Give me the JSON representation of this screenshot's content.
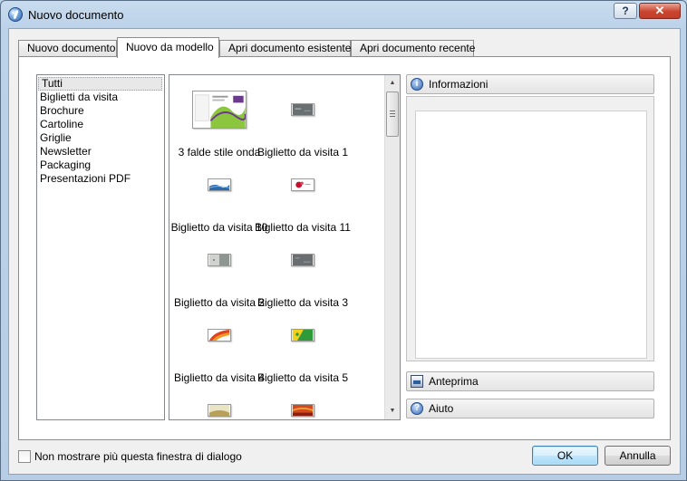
{
  "window": {
    "title": "Nuovo documento",
    "help_label": "?",
    "close_label": "✕"
  },
  "tabs": [
    {
      "label": "Nuovo documento",
      "active": false
    },
    {
      "label": "Nuovo da modello",
      "active": true
    },
    {
      "label": "Apri documento esistente",
      "active": false
    },
    {
      "label": "Apri documento recente",
      "active": false
    }
  ],
  "categories": {
    "selected": "Tutti",
    "items": [
      "Tutti",
      "Biglietti da visita",
      "Brochure",
      "Cartoline",
      "Griglie",
      "Newsletter",
      "Packaging",
      "Presentazioni PDF"
    ]
  },
  "templates": [
    {
      "label": "3 falde stile onda",
      "icon": "brochure-thumbnail",
      "colors": [
        "#ffffff",
        "#8cc63f",
        "#6b3a8c"
      ]
    },
    {
      "label": "Biglietto da visita 1",
      "icon": "business-card-thumbnail",
      "colors": [
        "#6a6f72",
        "#9aa0a3"
      ]
    },
    {
      "label": "Biglietto da visita 10",
      "icon": "business-card-thumbnail",
      "colors": [
        "#ffffff",
        "#2a6aad"
      ]
    },
    {
      "label": "Biglietto da visita 11",
      "icon": "business-card-thumbnail",
      "colors": [
        "#ffffff",
        "#c8102e"
      ]
    },
    {
      "label": "Biglietto da visita 2",
      "icon": "business-card-thumbnail",
      "colors": [
        "#cfd3cf",
        "#8e9692"
      ]
    },
    {
      "label": "Biglietto da visita 3",
      "icon": "business-card-thumbnail",
      "colors": [
        "#6a6e70",
        "#a3a8aa"
      ]
    },
    {
      "label": "Biglietto da visita 4",
      "icon": "business-card-thumbnail",
      "colors": [
        "#ffffff",
        "#e2431e"
      ]
    },
    {
      "label": "Biglietto da visita 5",
      "icon": "business-card-thumbnail",
      "colors": [
        "#2f9a3a",
        "#f2d11a"
      ]
    },
    {
      "label": "",
      "icon": "business-card-thumbnail",
      "colors": [
        "#e9e4c2",
        "#b89f5a"
      ]
    },
    {
      "label": "",
      "icon": "business-card-thumbnail",
      "colors": [
        "#d24b1e",
        "#8a1f12"
      ]
    }
  ],
  "side_panel": {
    "info_label": "Informazioni",
    "preview_label": "Anteprima",
    "help_label": "Aiuto"
  },
  "footer": {
    "checkbox_label": "Non mostrare più questa finestra di dialogo",
    "checkbox_checked": false,
    "ok_label": "OK",
    "cancel_label": "Annulla"
  },
  "scrollbar": {
    "up_arrow": "▲",
    "down_arrow": "▼"
  }
}
